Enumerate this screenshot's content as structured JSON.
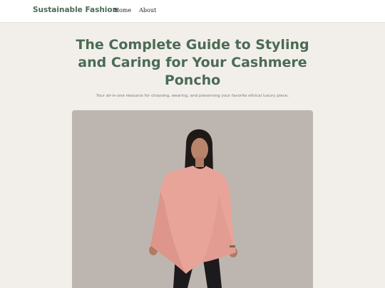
{
  "header": {
    "brand": "Sustainable Fashion",
    "nav": [
      {
        "label": "Home"
      },
      {
        "label": "About"
      }
    ]
  },
  "main": {
    "title": "The Complete Guide to Styling and Caring for Your Cashmere Poncho",
    "subtitle": "Your all-in-one resource for choosing, wearing, and preserving your favorite ethical luxury piece.",
    "hero_image": {
      "subject": "woman-wearing-pink-cashmere-poncho",
      "background_color": "#bdb6b0",
      "poncho_color": "#e9a49a"
    }
  },
  "colors": {
    "accent": "#4a6b55",
    "page_background": "#f2efea",
    "header_background": "#ffffff"
  }
}
